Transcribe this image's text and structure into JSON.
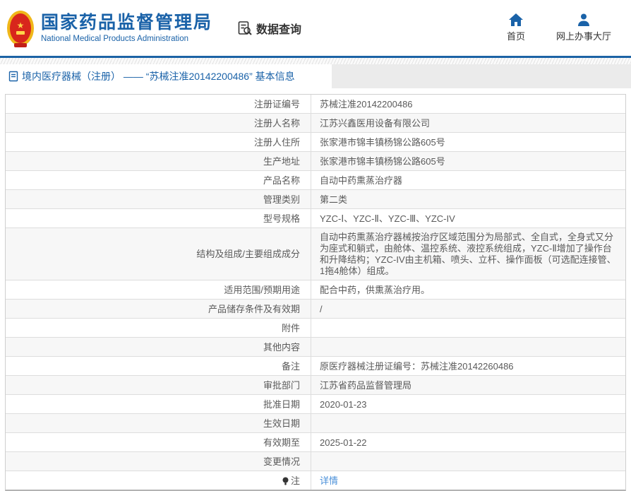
{
  "colors": {
    "brand_blue": "#1a62a8",
    "link_blue": "#4a90d9",
    "header_rule": "#1c63a5"
  },
  "header": {
    "org_name_cn": "国家药品监督管理局",
    "org_name_en": "National Medical Products Administration",
    "query_label": "数据查询",
    "nav": {
      "home": "首页",
      "hall": "网上办事大厅"
    }
  },
  "breadcrumb": {
    "text": "境内医疗器械（注册） —— “苏械注准20142200486” 基本信息"
  },
  "table": {
    "rows": [
      {
        "label": "注册证编号",
        "value": "苏械注准20142200486"
      },
      {
        "label": "注册人名称",
        "value": "江苏兴鑫医用设备有限公司"
      },
      {
        "label": "注册人住所",
        "value": "张家港市锦丰镇杨锦公路605号"
      },
      {
        "label": "生产地址",
        "value": "张家港市锦丰镇杨锦公路605号"
      },
      {
        "label": "产品名称",
        "value": "自动中药熏蒸治疗器"
      },
      {
        "label": "管理类别",
        "value": "第二类"
      },
      {
        "label": "型号规格",
        "value": "YZC-Ⅰ、YZC-Ⅱ、YZC-Ⅲ、YZC-IV"
      },
      {
        "label": "结构及组成/主要组成成分",
        "value": "自动中药熏蒸治疗器械按治疗区域范围分为局部式、全自式，全身式又分为座式和躺式，由舱体、温控系统、液控系统组成，YZC-Ⅱ增加了操作台和升降结构；YZC-IV由主机箱、喷头、立杆、操作面板（可选配连接管、1拖4舱体）组成。"
      },
      {
        "label": "适用范围/预期用途",
        "value": "配合中药，供熏蒸治疗用。"
      },
      {
        "label": "产品储存条件及有效期",
        "value": "/"
      },
      {
        "label": "附件",
        "value": ""
      },
      {
        "label": "其他内容",
        "value": ""
      },
      {
        "label": "备注",
        "value": "原医疗器械注册证编号：苏械注准20142260486"
      },
      {
        "label": "审批部门",
        "value": "江苏省药品监督管理局"
      },
      {
        "label": "批准日期",
        "value": "2020-01-23"
      },
      {
        "label": "生效日期",
        "value": ""
      },
      {
        "label": "有效期至",
        "value": "2025-01-22"
      },
      {
        "label": "变更情况",
        "value": ""
      },
      {
        "label": "注",
        "value": "详情"
      }
    ]
  }
}
